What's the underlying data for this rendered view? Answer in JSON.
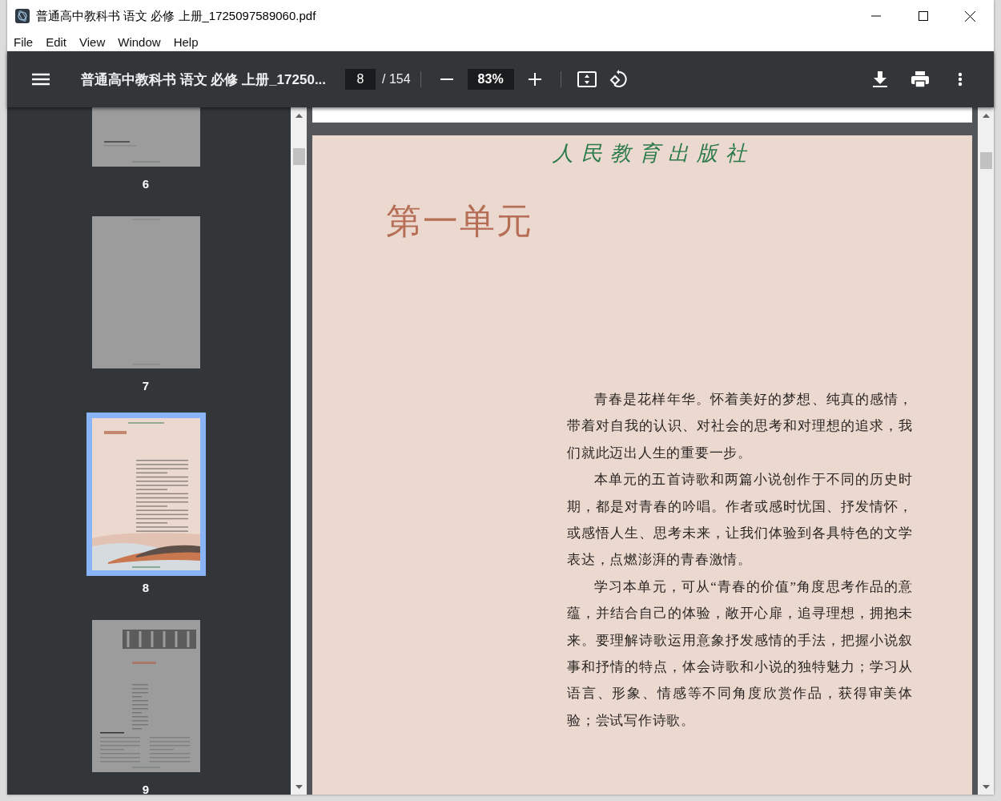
{
  "window": {
    "title": "普通高中教科书 语文 必修 上册_1725097589060.pdf"
  },
  "menu": [
    "File",
    "Edit",
    "View",
    "Window",
    "Help"
  ],
  "toolbar": {
    "document_title": "普通高中教科书 语文 必修 上册_17250...",
    "page_input": "8",
    "page_count": "/ 154",
    "zoom": "83%"
  },
  "thumbnails": [
    {
      "label": "6",
      "kind": "text",
      "selected": false
    },
    {
      "label": "7",
      "kind": "blank",
      "selected": false
    },
    {
      "label": "8",
      "kind": "unit",
      "selected": true
    },
    {
      "label": "9",
      "kind": "poem",
      "selected": false
    }
  ],
  "page": {
    "publisher": "人民教育出版社",
    "heading": "第一单元",
    "paragraphs": [
      "青春是花样年华。怀着美好的梦想、纯真的感情，带着对自我的认识、对社会的思考和对理想的追求，我们就此迈出人生的重要一步。",
      "本单元的五首诗歌和两篇小说创作于不同的历史时期，都是对青春的吟唱。作者或感时忧国、抒发情怀，或感悟人生、思考未来，让我们体验到各具特色的文学表达，点燃澎湃的青春激情。",
      "学习本单元，可从“青春的价值”角度思考作品的意蕴，并结合自己的体验，敞开心扉，追寻理想，拥抱未来。要理解诗歌运用意象抒发感情的手法，把握小说叙事和抒情的特点，体会诗歌和小说的独特魅力；学习从语言、形象、情感等不同角度欣赏作品，获得审美体验；尝试写作诗歌。"
    ]
  }
}
